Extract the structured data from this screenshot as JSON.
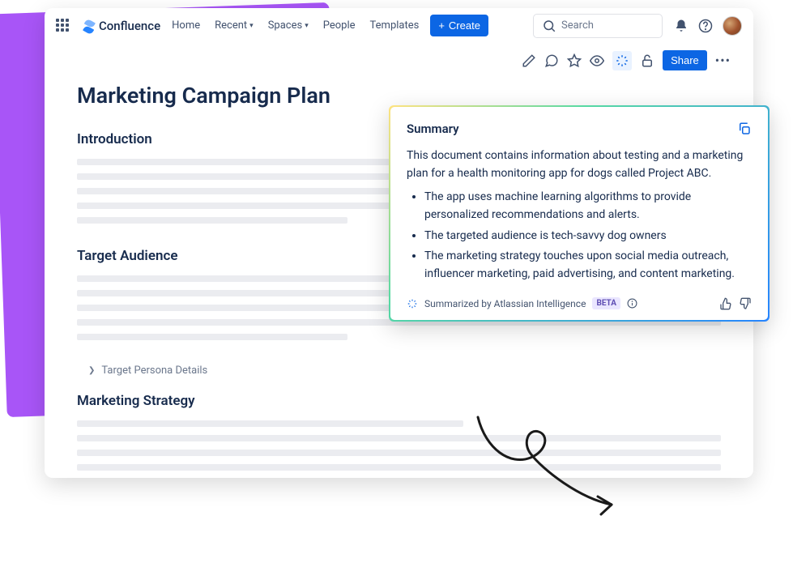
{
  "header": {
    "product_name": "Confluence",
    "nav": {
      "home": "Home",
      "recent": "Recent",
      "spaces": "Spaces",
      "people": "People",
      "templates": "Templates"
    },
    "create_label": "Create",
    "search_placeholder": "Search"
  },
  "page_toolbar": {
    "share_label": "Share"
  },
  "document": {
    "title": "Marketing Campaign Plan",
    "sections": {
      "intro": "Introduction",
      "audience": "Target Audience",
      "persona_expand": "Target Persona Details",
      "strategy": "Marketing Strategy"
    }
  },
  "summary": {
    "heading": "Summary",
    "body": "This document contains information about testing and a marketing plan for a health monitoring app for dogs called Project ABC.",
    "bullets": [
      "The app uses machine learning algorithms to provide personalized recommendations and alerts.",
      "The targeted audience is tech-savvy dog owners",
      "The marketing strategy touches upon social media outreach, influencer marketing, paid advertising, and content marketing."
    ],
    "attribution": "Summarized by Atlassian Intelligence",
    "beta_label": "BETA"
  }
}
